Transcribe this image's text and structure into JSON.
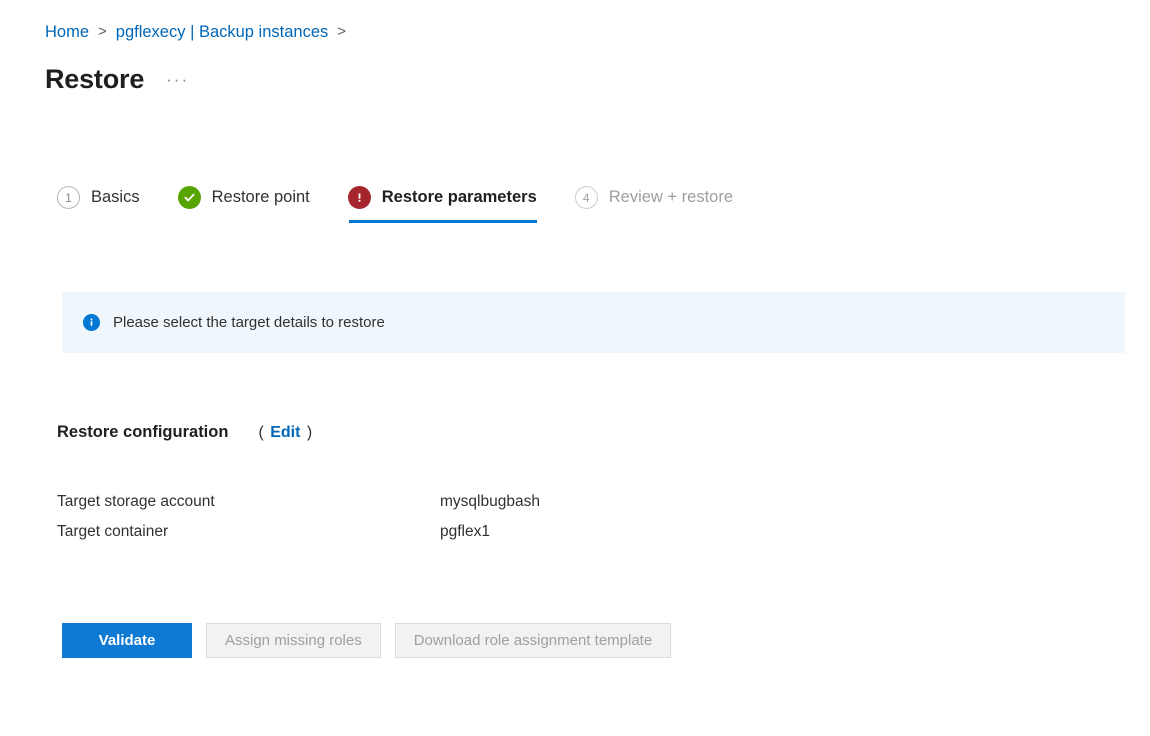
{
  "breadcrumb": {
    "items": [
      {
        "label": "Home"
      },
      {
        "label": "pgflexecy | Backup instances"
      }
    ],
    "separator": ">"
  },
  "header": {
    "title": "Restore",
    "more_menu": "···"
  },
  "wizard": {
    "steps": [
      {
        "badge": "1",
        "badge_type": "number",
        "label": "Basics",
        "state": "pending"
      },
      {
        "badge": "check-icon",
        "badge_type": "success",
        "label": "Restore point",
        "state": "complete"
      },
      {
        "badge": "error-icon",
        "badge_type": "error",
        "label": "Restore parameters",
        "state": "active"
      },
      {
        "badge": "4",
        "badge_type": "number-dim",
        "label": "Review + restore",
        "state": "disabled"
      }
    ]
  },
  "info_banner": {
    "icon": "info-icon",
    "message": "Please select the target details to restore"
  },
  "restore_configuration": {
    "title": "Restore configuration",
    "paren_open": "(",
    "edit_label": "Edit",
    "paren_close": ")",
    "rows": [
      {
        "label": "Target storage account",
        "value": "mysqlbugbash"
      },
      {
        "label": "Target container",
        "value": "pgflex1"
      }
    ]
  },
  "actions": {
    "validate": "Validate",
    "assign_missing_roles": "Assign missing roles",
    "download_role_template": "Download role assignment template"
  },
  "colors": {
    "accent": "#0078d4",
    "link": "#0067b8",
    "success": "#57a300",
    "error": "#a4262c",
    "info_background": "#eff6fc",
    "disabled_text": "#a19f9d"
  }
}
